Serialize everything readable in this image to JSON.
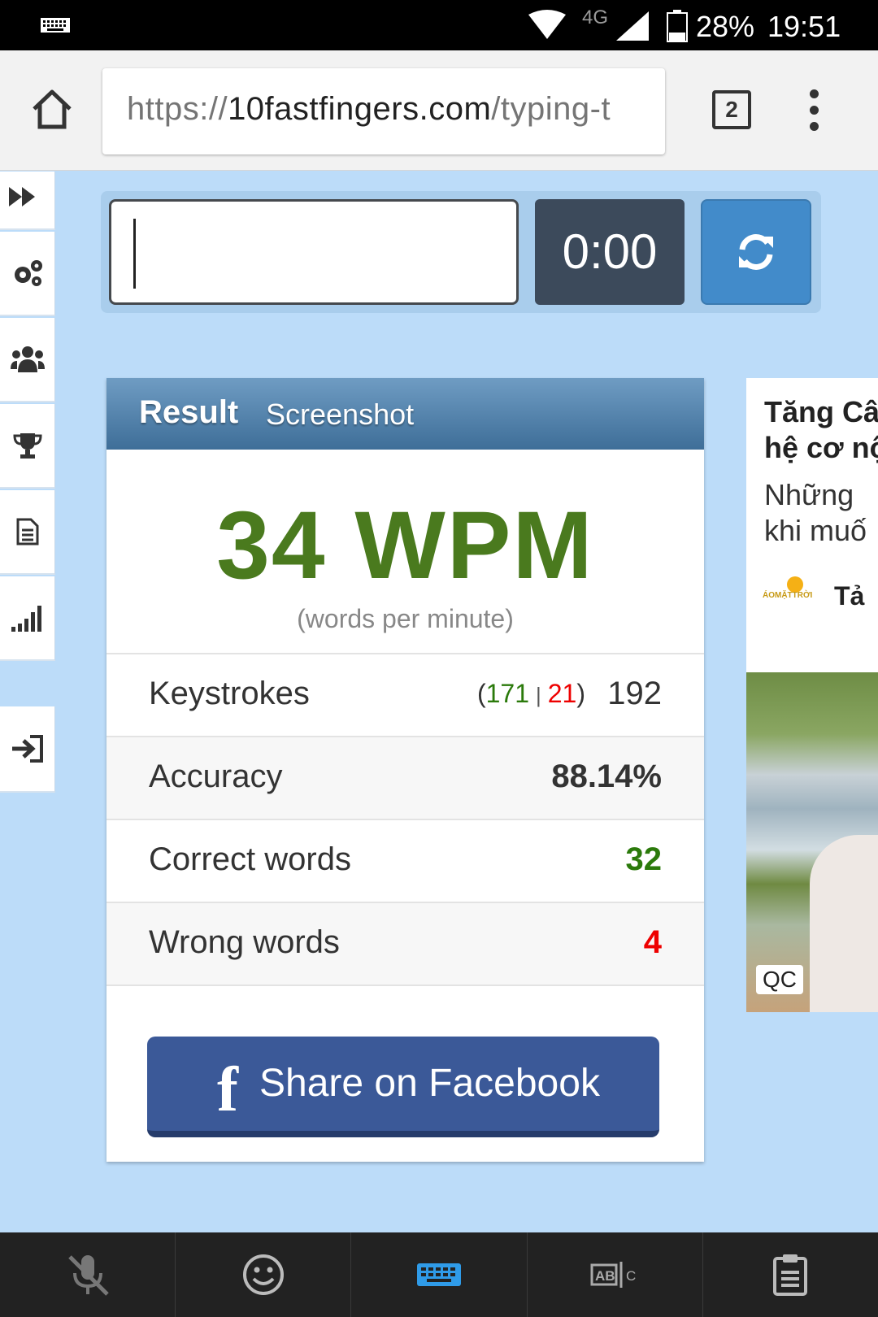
{
  "status_bar": {
    "network": "4G",
    "battery": "28%",
    "time": "19:51"
  },
  "browser": {
    "url_scheme": "https://",
    "url_host": "10fastfingers.com",
    "url_path": "/typing-t",
    "tab_count": "2"
  },
  "sidebar": {
    "items": [
      "fast-forward-icon",
      "settings-icon",
      "users-icon",
      "trophy-icon",
      "document-icon",
      "stats-icon",
      "login-icon"
    ]
  },
  "typing": {
    "input_value": "",
    "timer": "0:00"
  },
  "result": {
    "title": "Result",
    "tab": "Screenshot",
    "wpm": "34 WPM",
    "wpm_sub": "(words per minute)",
    "keystrokes_label": "Keystrokes",
    "keystrokes_correct": "171",
    "keystrokes_wrong": "21",
    "keystrokes_total": "192",
    "accuracy_label": "Accuracy",
    "accuracy_value": "88.14%",
    "correct_label": "Correct words",
    "correct_value": "32",
    "wrong_label": "Wrong words",
    "wrong_value": "4",
    "share_label": "Share on Facebook"
  },
  "ad": {
    "title": "Tăng Câ\nhệ cơ nộ",
    "desc": "Những\nkhi muố",
    "logo": "ÁOMẶTTRỜI",
    "brand": "Tả",
    "qc": "QC"
  },
  "colors": {
    "page_bg": "#bcdcf9",
    "wpm_green": "#4a7a1e",
    "correct_green": "#2b7a0b",
    "wrong_red": "#ee0000",
    "facebook_blue": "#3b5998",
    "timer_bg": "#3c4a5b",
    "reload_blue": "#428bca"
  },
  "keyboard_bar": {
    "items": [
      "mic-off-icon",
      "emoji-icon",
      "keyboard-icon",
      "spellcheck-icon",
      "clipboard-icon"
    ]
  }
}
